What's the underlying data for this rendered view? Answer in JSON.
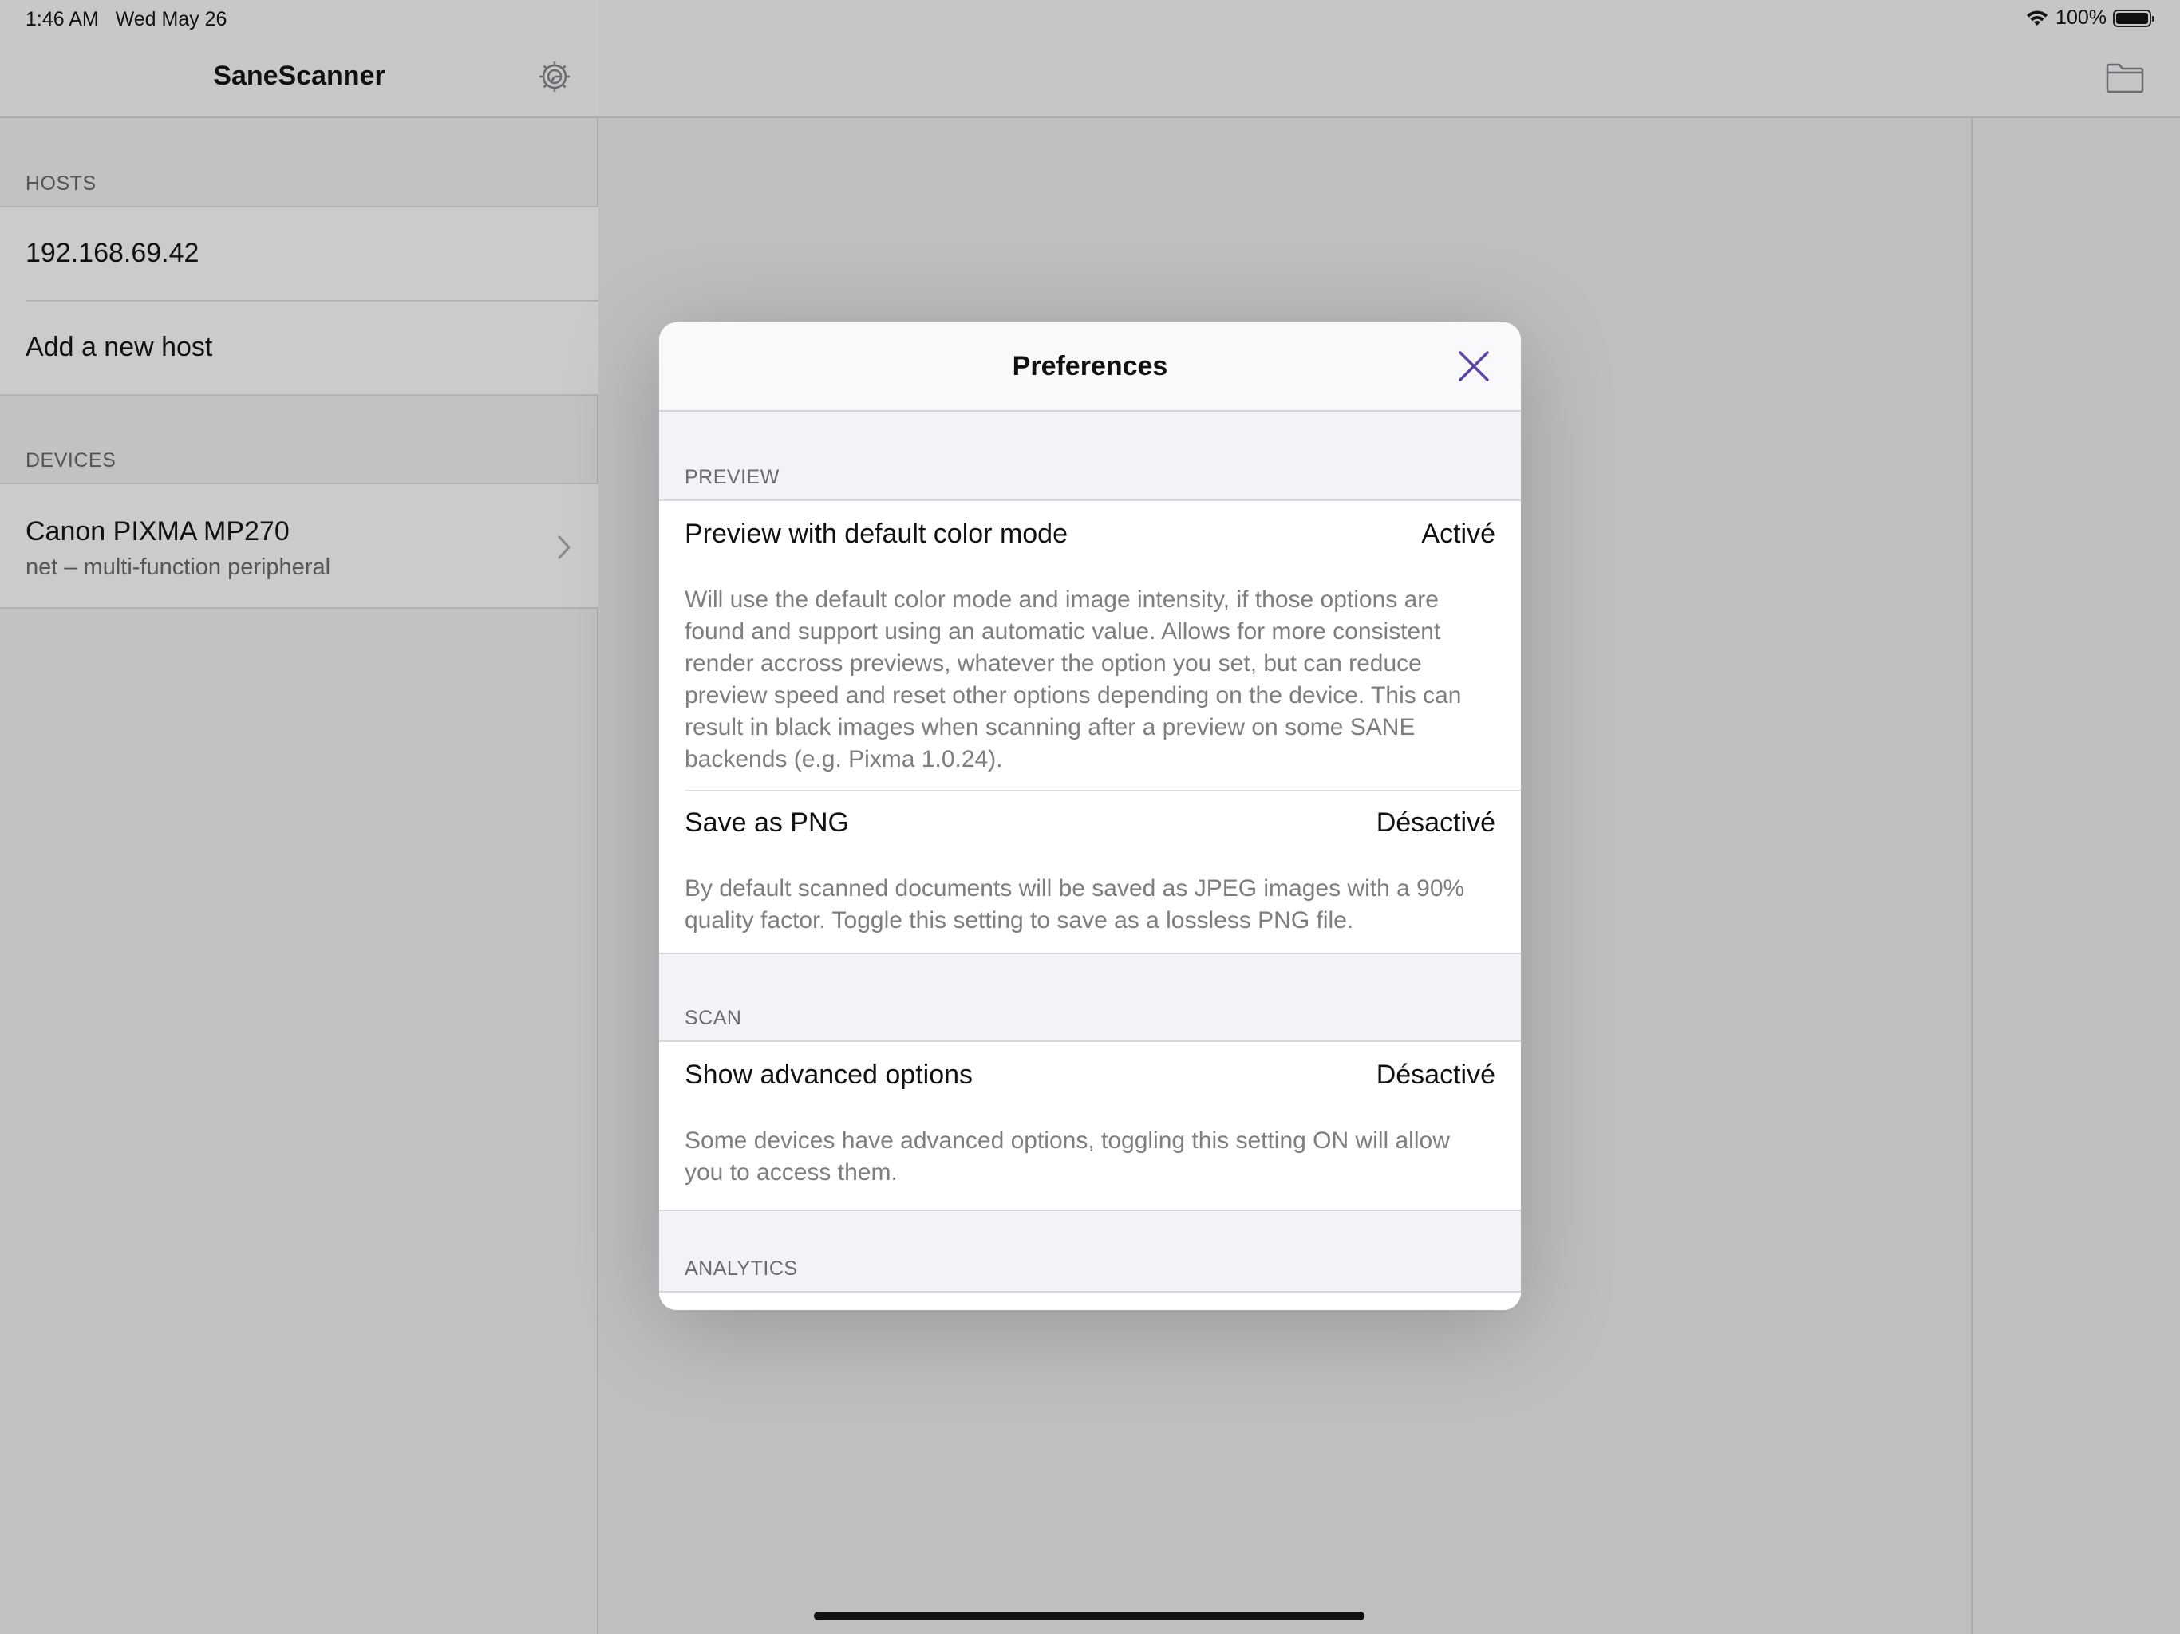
{
  "status_bar": {
    "time": "1:46 AM",
    "date": "Wed May 26",
    "battery_text": "100%",
    "battery_level": 1.0
  },
  "sidebar": {
    "title": "SaneScanner",
    "hosts_header": "HOSTS",
    "hosts": [
      "192.168.69.42",
      "Add a new host"
    ],
    "devices_header": "DEVICES",
    "devices": [
      {
        "name": "Canon PIXMA MP270",
        "subtitle": "net – multi-function peripheral"
      }
    ]
  },
  "modal": {
    "title": "Preferences",
    "sections": [
      {
        "header": "PREVIEW",
        "rows": [
          {
            "label": "Preview with default color mode",
            "value": "Activé",
            "description": "Will use the default color mode and image intensity, if those options are found and support using an automatic value. Allows for more consistent render accross previews, whatever the option you set, but can reduce preview speed and reset other options depending on the device. This can result in black images when scanning after a preview on some SANE backends (e.g. Pixma 1.0.24)."
          },
          {
            "label": "Save as PNG",
            "value": "Désactivé",
            "description": "By default scanned documents will be saved as JPEG images with a 90% quality factor. Toggle this setting to save as a lossless PNG file."
          }
        ]
      },
      {
        "header": "SCAN",
        "rows": [
          {
            "label": "Show advanced options",
            "value": "Désactivé",
            "description": "Some devices have advanced options, toggling this setting ON will allow you to access them."
          }
        ]
      },
      {
        "header": "ANALYTICS",
        "rows": []
      }
    ]
  },
  "colors": {
    "accent": "#5e44a6",
    "dim_background": "#c4c4c6",
    "modal_background": "#f2f2f7"
  },
  "icons": {
    "settings": "gear-icon",
    "folder": "folder-icon",
    "close": "close-icon",
    "disclosure": "chevron-right-icon",
    "wifi": "wifi-icon",
    "battery": "battery-icon"
  }
}
